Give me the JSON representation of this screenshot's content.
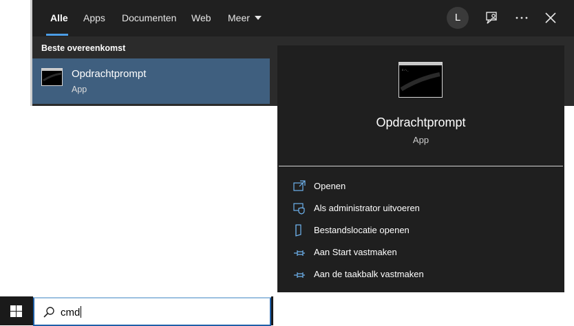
{
  "tabs": [
    {
      "label": "Alle"
    },
    {
      "label": "Apps"
    },
    {
      "label": "Documenten"
    },
    {
      "label": "Web"
    },
    {
      "label": "Meer"
    }
  ],
  "user_initial": "L",
  "results": {
    "section_title": "Beste overeenkomst",
    "top_result": {
      "title": "Opdrachtprompt",
      "subtitle": "App"
    }
  },
  "preview": {
    "title": "Opdrachtprompt",
    "subtitle": "App",
    "actions": [
      {
        "label": "Openen",
        "icon": "open-icon"
      },
      {
        "label": "Als administrator uitvoeren",
        "icon": "shield-icon"
      },
      {
        "label": "Bestandslocatie openen",
        "icon": "file-location-icon"
      },
      {
        "label": "Aan Start vastmaken",
        "icon": "pin-icon"
      },
      {
        "label": "Aan de taakbalk vastmaken",
        "icon": "pin-icon"
      }
    ]
  },
  "taskbar": {
    "search_value": "cmd"
  },
  "colors": {
    "accent": "#4c9de6",
    "selected_result": "#3f5f7f",
    "panel": "#1f1f1f"
  }
}
